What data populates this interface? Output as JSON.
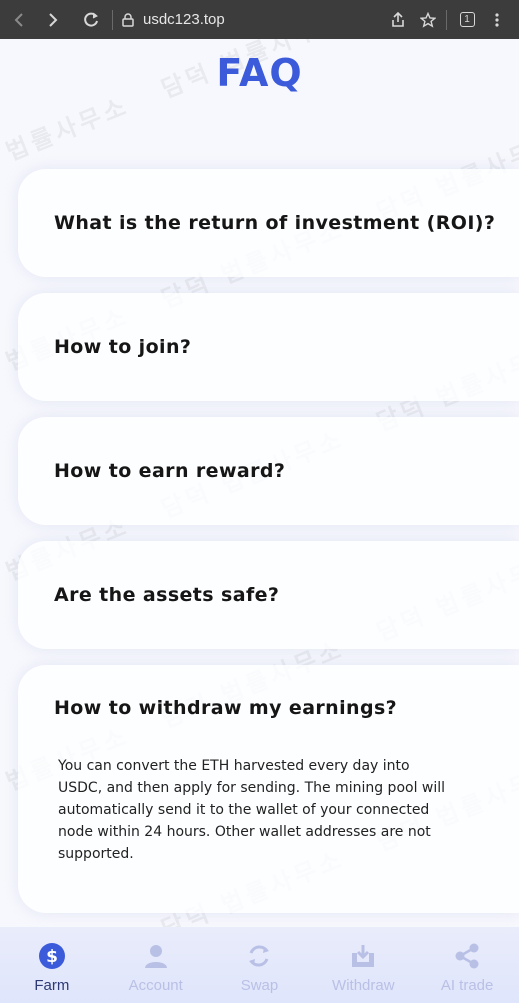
{
  "browser": {
    "url": "usdc123.top",
    "tab_count": "1"
  },
  "page": {
    "title": "FAQ",
    "watermark_text": "담덕 법률사무소"
  },
  "faq": [
    {
      "question": "What is the return of investment (ROI)?",
      "expanded": false
    },
    {
      "question": "How to join?",
      "expanded": false
    },
    {
      "question": "How to earn reward?",
      "expanded": false
    },
    {
      "question": "Are the assets safe?",
      "expanded": false
    },
    {
      "question": "How to withdraw my earnings?",
      "expanded": true,
      "answer": "You can convert the ETH harvested every day into USDC, and then apply for sending. The mining pool will automatically send it to the wallet of your connected node within 24 hours. Other wallet addresses are not supported."
    }
  ],
  "bottom_nav": [
    {
      "label": "Farm",
      "icon": "dollar-circle-icon",
      "active": true
    },
    {
      "label": "Account",
      "icon": "user-icon",
      "active": false
    },
    {
      "label": "Swap",
      "icon": "swap-icon",
      "active": false
    },
    {
      "label": "Withdraw",
      "icon": "withdraw-icon",
      "active": false
    },
    {
      "label": "AI trade",
      "icon": "share-icon",
      "active": false
    }
  ],
  "colors": {
    "accent": "#3b5bdb",
    "nav_active": "#2d3a74",
    "nav_inactive": "#b9c0e6"
  }
}
